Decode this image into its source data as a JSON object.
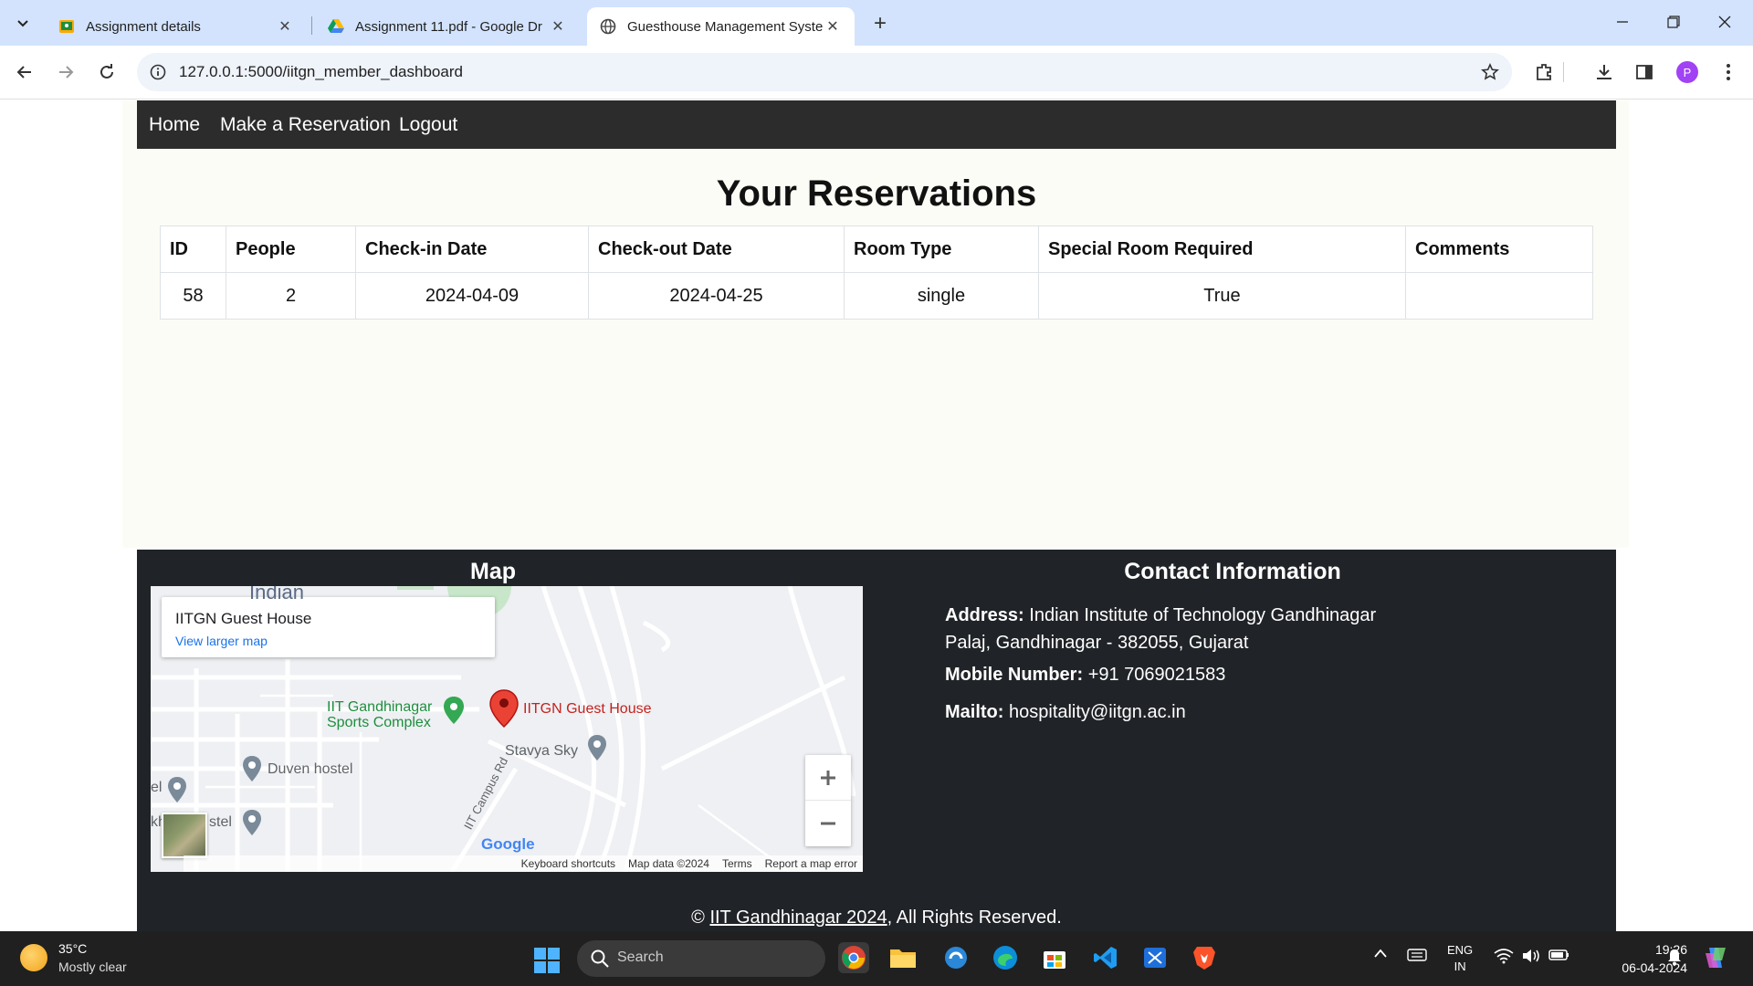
{
  "browser": {
    "tabs": [
      {
        "title": "Assignment details",
        "favicon": "classroom-icon",
        "active": false
      },
      {
        "title": "Assignment 11.pdf - Google Dr",
        "favicon": "google-drive-icon",
        "active": false
      },
      {
        "title": "Guesthouse Management Syste",
        "favicon": "globe-icon",
        "active": true
      }
    ],
    "url": "127.0.0.1:5000/iitgn_member_dashboard",
    "profile_initial": "P"
  },
  "nav": {
    "home": "Home",
    "reserve": "Make a Reservation",
    "logout": "Logout"
  },
  "page": {
    "title": "Your Reservations"
  },
  "reservations": {
    "headers": [
      "ID",
      "People",
      "Check-in Date",
      "Check-out Date",
      "Room Type",
      "Special Room Required",
      "Comments"
    ],
    "rows": [
      [
        "58",
        "2",
        "2024-04-09",
        "2024-04-25",
        "single",
        "True",
        ""
      ]
    ]
  },
  "footer": {
    "map_heading": "Map",
    "contact_heading": "Contact Information",
    "map": {
      "place_name": "IITGN Guest House",
      "view_larger": "View larger map",
      "labels": {
        "pin": "IITGN Guest House",
        "sports_1": "IIT Gandhinagar",
        "sports_2": "Sports Complex",
        "stavya": "Stavya Sky",
        "duven": "Duven hostel",
        "hostel": "stel",
        "el": "el",
        "kh": "kh",
        "road": "IIT Campus Rd",
        "indian": "Indian"
      },
      "attribution": [
        "Keyboard shortcuts",
        "Map data ©2024",
        "Terms",
        "Report a map error"
      ],
      "logo": "Google"
    },
    "address_label": "Address:",
    "address_line1": "Indian Institute of Technology Gandhinagar",
    "address_line2": "Palaj, Gandhinagar - 382055, Gujarat",
    "mobile_label": "Mobile Number:",
    "mobile": "+91 7069021583",
    "mail_label": "Mailto:",
    "mail": "hospitality@iitgn.ac.in",
    "copyright_prefix": "©",
    "copyright_link": "IIT Gandhinagar 2024",
    "copyright_suffix": ", All Rights Reserved."
  },
  "taskbar": {
    "weather_temp": "35°C",
    "weather_desc": "Mostly clear",
    "search_label": "Search",
    "lang_1": "ENG",
    "lang_2": "IN",
    "time": "19:26",
    "date": "06-04-2024"
  }
}
